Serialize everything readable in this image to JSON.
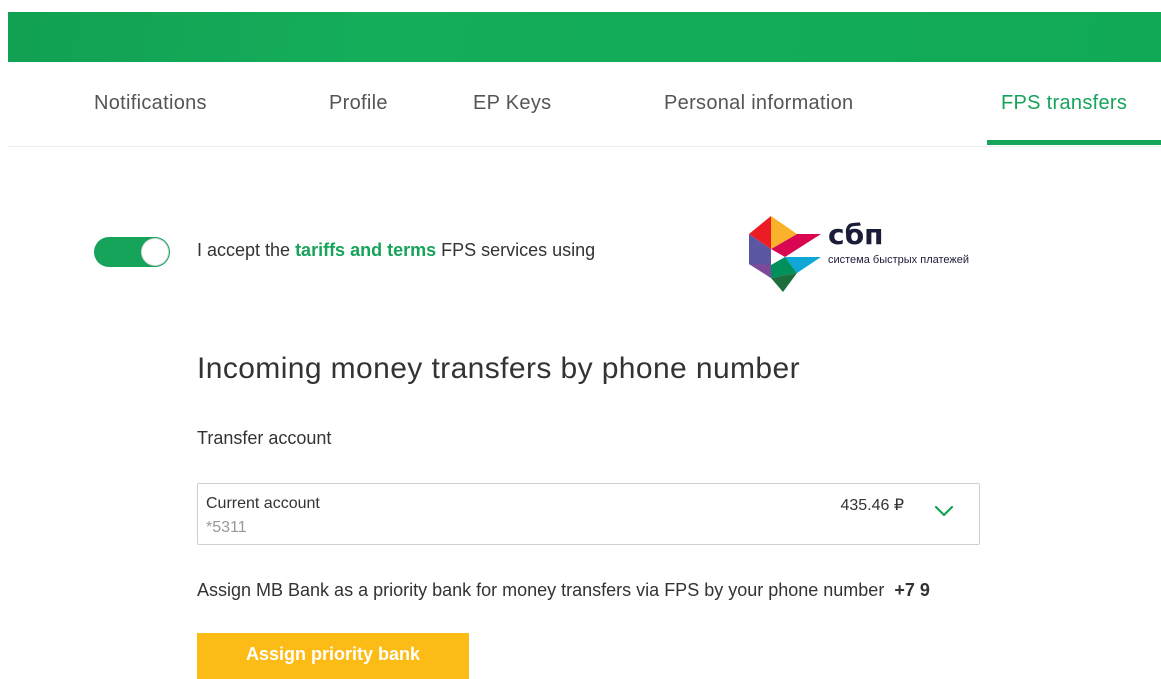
{
  "colors": {
    "brand_green": "#16a35a",
    "banner_green": "#13ac58",
    "button_yellow": "#fdbb15"
  },
  "tabs": [
    {
      "label": "Notifications",
      "active": false
    },
    {
      "label": "Profile",
      "active": false
    },
    {
      "label": "EP Keys",
      "active": false
    },
    {
      "label": "Personal information",
      "active": false
    },
    {
      "label": "FPS transfers",
      "active": true
    }
  ],
  "accept": {
    "toggle_on": true,
    "prefix": "I accept the ",
    "link": "tariffs and terms",
    "suffix": " FPS services using"
  },
  "sbp_logo": {
    "word": "сбп",
    "subtitle": "система быстрых платежей",
    "icon": "sbp-logo-icon"
  },
  "section": {
    "title": "Incoming money transfers by phone number"
  },
  "transfer_account": {
    "label": "Transfer account",
    "name": "Current account",
    "number": "*5311",
    "balance": "435.46 ₽",
    "icon": "chevron-down-icon"
  },
  "assign": {
    "text": "Assign MB Bank as a priority bank for money transfers via FPS by your phone number",
    "phone": "+7 9",
    "button_label": "Assign priority bank"
  }
}
